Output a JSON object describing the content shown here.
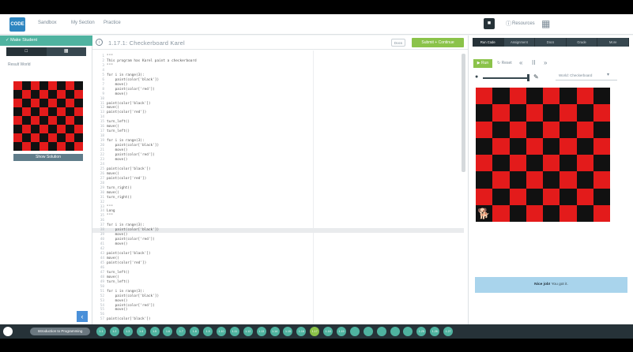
{
  "topbar": {
    "logo": "CODE",
    "nav": [
      "Sandbox",
      "My Section",
      "Practice"
    ],
    "resources": "Resources"
  },
  "leftpanel": {
    "make_student": "Make Student",
    "tabs": [
      "□",
      "▦"
    ],
    "result_label": "Result World",
    "show_solution": "Show Solution"
  },
  "editor": {
    "title": "1.17.1: Checkerboard Karel",
    "docs_label": "Docs",
    "submit_label": "Submit + Continue",
    "highlighted_line": 38,
    "lines": [
      "\"\"\"",
      "This program has Karel paint a checkerboard",
      "\"\"\"",
      "",
      "for i in range(3):",
      "    paint(color['black'])",
      "    move()",
      "    paint(color['red'])",
      "    move()",
      "",
      "paint(color['black'])",
      "move()",
      "paint(color['red'])",
      "",
      "turn_left()",
      "move()",
      "turn_left()",
      "",
      "for i in range(3):",
      "    paint(color['black'])",
      "    move()",
      "    paint(color['red'])",
      "    move()",
      "",
      "paint(color['black'])",
      "move()",
      "paint(color['red'])",
      "",
      "turn_right()",
      "move()",
      "turn_right()",
      "",
      "\"\"\"",
      "Long",
      "\"\"\"",
      "",
      "for i in range(3):",
      "    paint(color['black'])",
      "    move()",
      "    paint(color['red'])",
      "    move()",
      "",
      "paint(color['black'])",
      "move()",
      "paint(color['red'])",
      "",
      "turn_left()",
      "move()",
      "turn_left()",
      "",
      "for i in range(3):",
      "    paint(color['black'])",
      "    move()",
      "    paint(color['red'])",
      "    move()",
      "",
      "paint(color['black'])"
    ]
  },
  "bottombar": {
    "introduction": "Introduction to Programming",
    "dots": [
      "1.1",
      "1.2",
      "1.3",
      "1.4",
      "1.5",
      "1.6",
      "1.7",
      "1.8",
      "1.9",
      "1.10",
      "1.11",
      "1.12",
      "1.13",
      "1.14",
      "1.15",
      "1.16",
      "1.17",
      "1.18",
      "1.19",
      "",
      "",
      "",
      "",
      "",
      "1.25",
      "1.26",
      "1.27"
    ]
  },
  "rightpanel": {
    "tabs": [
      "Run Code",
      "Assignment",
      "Docs",
      "Grade",
      "More"
    ],
    "run_label": "▶ Run",
    "reset_label": "↻ Reset",
    "step_icons": [
      "«",
      "II",
      "»"
    ],
    "world_select": "World: Checkerboard",
    "status_strong": "Nice job!",
    "status_text": "You got it."
  },
  "colors": {
    "accent": "#4fb3a0",
    "submit": "#8bc34a",
    "dark": "#263238",
    "red": "#e31b1b",
    "black": "#111111",
    "info": "#a9d4ec"
  }
}
